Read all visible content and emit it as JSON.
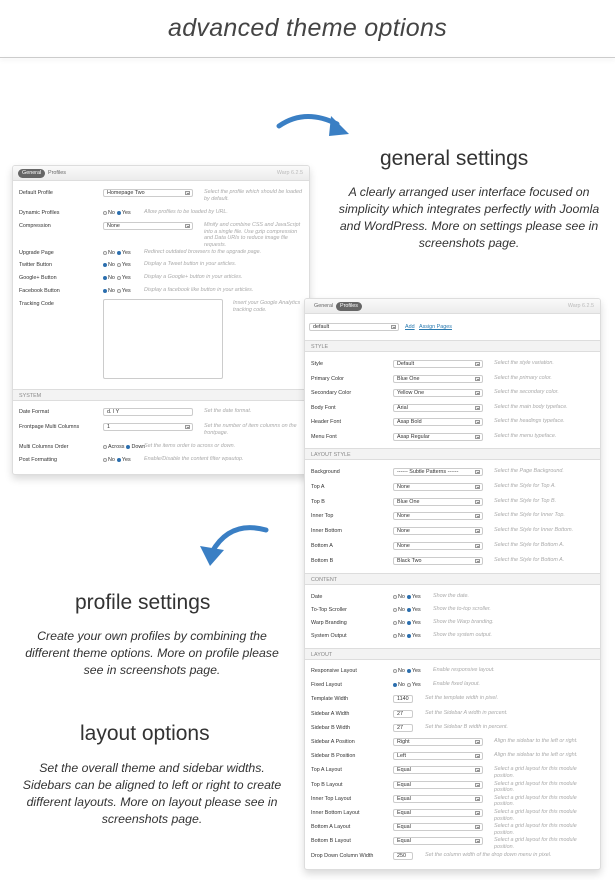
{
  "header": {
    "title": "advanced theme options"
  },
  "sections": {
    "general": {
      "title": "general settings",
      "text": "A clearly arranged user interface focused on simplicity which integrates perfectly with Joomla and WordPress. More on settings please see in screenshots page."
    },
    "profile": {
      "title": "profile settings",
      "text": "Create your own profiles by combining the different theme options. More on profile please see in screenshots page."
    },
    "layout": {
      "title": "layout options",
      "text": "Set the overall theme and sidebar widths. Sidebars can be aligned to left or right to create different layouts. More on layout please see in screenshots page."
    }
  },
  "colors": {
    "arrow": "#3a7fc4",
    "radio_selected": "#2c6fae",
    "link": "#2a7ab0"
  },
  "general_panel": {
    "tabs": [
      "General",
      "Profiles"
    ],
    "active_tab": 0,
    "version": "Warp 6.2.5",
    "headers": [
      "SYSTEM"
    ],
    "rows": [
      {
        "label": "Default Profile",
        "type": "select",
        "value": "Homepage Two",
        "help": "Select the profile which should be loaded by default."
      },
      {
        "label": "Dynamic Profiles",
        "type": "radio",
        "options": [
          "No",
          "Yes"
        ],
        "selected": 1,
        "help": "Allow profiles to be loaded by URL."
      },
      {
        "label": "Compression",
        "type": "select",
        "value": "None",
        "help": "Minify and combine CSS and JavaScript into a single file. Use gzip compression and Data URIs to reduce image file requests."
      },
      {
        "label": "Upgrade Page",
        "type": "radio",
        "options": [
          "No",
          "Yes"
        ],
        "selected": 1,
        "help": "Redirect outdated browsers to the upgrade page."
      },
      {
        "label": "Twitter Button",
        "type": "radio",
        "options": [
          "No",
          "Yes"
        ],
        "selected": 0,
        "help": "Display a Tweet button in your articles."
      },
      {
        "label": "Google+ Button",
        "type": "radio",
        "options": [
          "No",
          "Yes"
        ],
        "selected": 0,
        "help": "Display a Google+ button in your articles."
      },
      {
        "label": "Facebook Button",
        "type": "radio",
        "options": [
          "No",
          "Yes"
        ],
        "selected": 0,
        "help": "Display a facebook like button in your articles."
      },
      {
        "label": "Tracking Code",
        "type": "textarea",
        "value": "",
        "help": "Insert your Google Analytics tracking code."
      },
      {
        "label": "Date Format",
        "type": "text",
        "value": "d. l Y",
        "help": "Set the date format."
      },
      {
        "label": "Frontpage Multi Columns",
        "type": "select",
        "value": "1",
        "help": "Set the number of item columns on the frontpage."
      },
      {
        "label": "Multi Columns Order",
        "type": "radio",
        "options": [
          "Across",
          "Down"
        ],
        "selected": 1,
        "help": "Set the items order to across or down."
      },
      {
        "label": "Post Formatting",
        "type": "radio",
        "options": [
          "No",
          "Yes"
        ],
        "selected": 1,
        "help": "Enable/Disable the content filter wpautop."
      }
    ]
  },
  "profiles_panel": {
    "tabs": [
      "General",
      "Profiles"
    ],
    "active_tab": 1,
    "version": "Warp 6.2.5",
    "profile_select": "default",
    "add_link": "Add",
    "assign_link": "Assign Pages",
    "headers": [
      "STYLE",
      "LAYOUT STYLE",
      "CONTENT",
      "LAYOUT"
    ],
    "rows": [
      {
        "label": "Style",
        "type": "select",
        "value": "Default",
        "help": "Select the style variation."
      },
      {
        "label": "Primary Color",
        "type": "select",
        "value": "Blue One",
        "help": "Select the primary color."
      },
      {
        "label": "Secondary Color",
        "type": "select",
        "value": "Yellow One",
        "help": "Select the secondary color."
      },
      {
        "label": "Body Font",
        "type": "select",
        "value": "Arial",
        "help": "Select the main body typeface."
      },
      {
        "label": "Header Font",
        "type": "select",
        "value": "Asap Bold",
        "help": "Select the headings typeface."
      },
      {
        "label": "Menu Font",
        "type": "select",
        "value": "Asap Regular",
        "help": "Select the menu typeface."
      },
      {
        "label": "Background",
        "type": "select",
        "value": "------ Subtle Patterns ------",
        "help": "Select the Page Background."
      },
      {
        "label": "Top A",
        "type": "select",
        "value": "None",
        "help": "Select the Style for Top A."
      },
      {
        "label": "Top B",
        "type": "select",
        "value": "Blue One",
        "help": "Select the Style for Top B."
      },
      {
        "label": "Inner Top",
        "type": "select",
        "value": "None",
        "help": "Select the Style for Inner Top."
      },
      {
        "label": "Inner Bottom",
        "type": "select",
        "value": "None",
        "help": "Select the Style for Inner Bottom."
      },
      {
        "label": "Bottom A",
        "type": "select",
        "value": "None",
        "help": "Select the Style for Bottom A."
      },
      {
        "label": "Bottom B",
        "type": "select",
        "value": "Black Two",
        "help": "Select the Style for Bottom A."
      },
      {
        "label": "Date",
        "type": "radio",
        "options": [
          "No",
          "Yes"
        ],
        "selected": 1,
        "help": "Show the date."
      },
      {
        "label": "To-Top Scroller",
        "type": "radio",
        "options": [
          "No",
          "Yes"
        ],
        "selected": 1,
        "help": "Show the to-top scroller."
      },
      {
        "label": "Warp Branding",
        "type": "radio",
        "options": [
          "No",
          "Yes"
        ],
        "selected": 1,
        "help": "Show the Warp branding."
      },
      {
        "label": "System Output",
        "type": "radio",
        "options": [
          "No",
          "Yes"
        ],
        "selected": 1,
        "help": "Show the system output."
      },
      {
        "label": "Responsive Layout",
        "type": "radio",
        "options": [
          "No",
          "Yes"
        ],
        "selected": 1,
        "help": "Enable responsive layout."
      },
      {
        "label": "Fixed Layout",
        "type": "radio",
        "options": [
          "No",
          "Yes"
        ],
        "selected": 0,
        "help": "Enable fixed layout."
      },
      {
        "label": "Template Width",
        "type": "text",
        "value": "1140",
        "help": "Set the template width in pixel."
      },
      {
        "label": "Sidebar A Width",
        "type": "text",
        "value": "27",
        "help": "Set the Sidebar A width in percent."
      },
      {
        "label": "Sidebar B Width",
        "type": "text",
        "value": "27",
        "help": "Set the Sidebar B width in percent."
      },
      {
        "label": "Sidebar A Position",
        "type": "select",
        "value": "Right",
        "help": "Align the sidebar to the left or right."
      },
      {
        "label": "Sidebar B Position",
        "type": "select",
        "value": "Left",
        "help": "Align the sidebar to the left or right."
      },
      {
        "label": "Top A Layout",
        "type": "select",
        "value": "Equal",
        "help": "Select a grid layout for this module position."
      },
      {
        "label": "Top B Layout",
        "type": "select",
        "value": "Equal",
        "help": "Select a grid layout for this module position."
      },
      {
        "label": "Inner Top Layout",
        "type": "select",
        "value": "Equal",
        "help": "Select a grid layout for this module position."
      },
      {
        "label": "Inner Bottom Layout",
        "type": "select",
        "value": "Equal",
        "help": "Select a grid layout for this module position."
      },
      {
        "label": "Bottom A Layout",
        "type": "select",
        "value": "Equal",
        "help": "Select a grid layout for this module position."
      },
      {
        "label": "Bottom B Layout",
        "type": "select",
        "value": "Equal",
        "help": "Select a grid layout for this module position."
      },
      {
        "label": "Drop Down Column Width",
        "type": "text",
        "value": "250",
        "help": "Set the column width of the drop down menu in pixel."
      }
    ]
  }
}
